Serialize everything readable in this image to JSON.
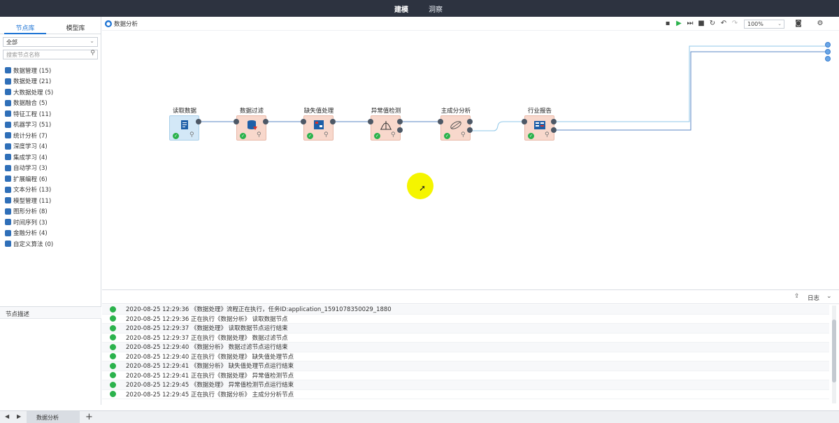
{
  "topbar": {
    "tabs": [
      {
        "label": "建模",
        "active": true
      },
      {
        "label": "洞察",
        "active": false
      }
    ]
  },
  "left": {
    "tabs": [
      {
        "label": "节点库",
        "active": true
      },
      {
        "label": "模型库",
        "active": false
      }
    ],
    "filter_value": "全部",
    "search_placeholder": "搜索节点名称",
    "categories": [
      {
        "label": "数据管理 (15)",
        "icon": "database-icon"
      },
      {
        "label": "数据处理 (21)",
        "icon": "process-icon"
      },
      {
        "label": "大数据处理 (5)",
        "icon": "bigdata-icon"
      },
      {
        "label": "数据融合 (5)",
        "icon": "merge-icon"
      },
      {
        "label": "特征工程 (11)",
        "icon": "feature-icon"
      },
      {
        "label": "机器学习 (51)",
        "icon": "ml-icon"
      },
      {
        "label": "统计分析 (7)",
        "icon": "stats-icon"
      },
      {
        "label": "深度学习 (4)",
        "icon": "dl-icon"
      },
      {
        "label": "集成学习 (4)",
        "icon": "ensemble-icon"
      },
      {
        "label": "自动学习 (3)",
        "icon": "automl-icon"
      },
      {
        "label": "扩展编程 (6)",
        "icon": "code-icon"
      },
      {
        "label": "文本分析 (13)",
        "icon": "text-icon"
      },
      {
        "label": "模型管理 (11)",
        "icon": "model-icon"
      },
      {
        "label": "图形分析 (8)",
        "icon": "graph-icon"
      },
      {
        "label": "时间序列 (3)",
        "icon": "timeseries-icon"
      },
      {
        "label": "金融分析 (4)",
        "icon": "finance-icon"
      },
      {
        "label": "自定义算法 (0)",
        "icon": "custom-icon"
      }
    ],
    "desc_header": "节点描述"
  },
  "canvas_header": {
    "flow_title": "数据分析",
    "zoom": "100%"
  },
  "nodes": [
    {
      "name": "node-read-data",
      "label": "读取数据",
      "color": "blue"
    },
    {
      "name": "node-data-filter",
      "label": "数据过滤",
      "color": "pink"
    },
    {
      "name": "node-missing-values",
      "label": "缺失值处理",
      "color": "pink"
    },
    {
      "name": "node-outlier-detect",
      "label": "异常值检测",
      "color": "pink"
    },
    {
      "name": "node-pca",
      "label": "主成分分析",
      "color": "pink"
    },
    {
      "name": "node-industry-report",
      "label": "行业报告",
      "color": "pink"
    }
  ],
  "log": {
    "label": "日志",
    "entries": [
      "2020-08-25 12:29:36 《数据处理》流程正在执行，任务ID:application_1591078350029_1880",
      "2020-08-25 12:29:36 正在执行《数据分析》 读取数据节点",
      "2020-08-25 12:29:37 《数据处理》 读取数据节点运行结束",
      "2020-08-25 12:29:37 正在执行《数据处理》 数据过滤节点",
      "2020-08-25 12:29:40 《数据分析》 数据过滤节点运行结束",
      "2020-08-25 12:29:40 正在执行《数据处理》 缺失值处理节点",
      "2020-08-25 12:29:41 《数据分析》 缺失值处理节点运行结束",
      "2020-08-25 12:29:41 正在执行《数据处理》 异常值检测节点",
      "2020-08-25 12:29:45 《数据处理》 异常值检测节点运行结束",
      "2020-08-25 12:29:45 正在执行《数据分析》 主成分分析节点"
    ]
  },
  "bottombar": {
    "tab_label": "数据分析",
    "add_label": "+"
  },
  "colors": {
    "accent": "#1e74d4",
    "success": "#2bb24c",
    "node_pink": "#f8d8cc",
    "node_blue": "#d3e8f7",
    "topbar": "#2d3340"
  }
}
